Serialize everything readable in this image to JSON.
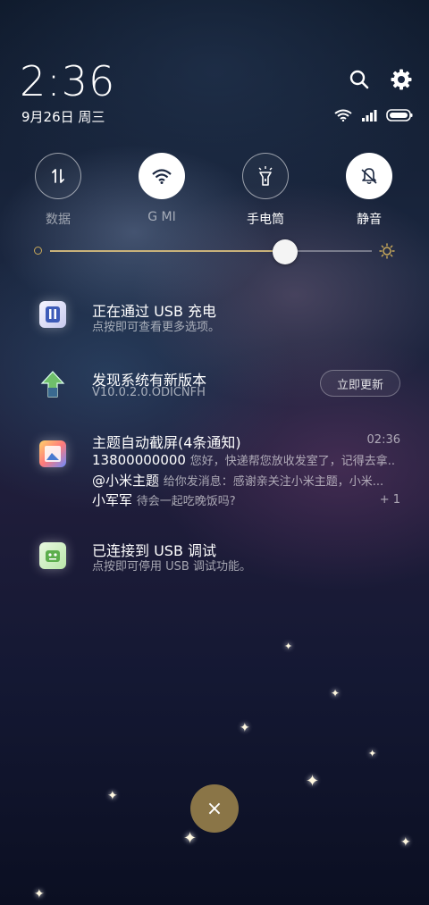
{
  "header": {
    "time": "2:36",
    "date": "9月26日 周三"
  },
  "toggles": [
    {
      "label": "数据",
      "state": "off",
      "icon": "data-arrows-icon"
    },
    {
      "label": "G    MI",
      "state": "on",
      "icon": "wifi-icon"
    },
    {
      "label": "手电筒",
      "state": "off",
      "icon": "flashlight-icon"
    },
    {
      "label": "静音",
      "state": "on",
      "icon": "bell-off-icon"
    }
  ],
  "brightness": {
    "level": 0.73
  },
  "notifications": {
    "usb_charging": {
      "title": "正在通过 USB 充电",
      "subtitle": "点按即可查看更多选项。"
    },
    "system_update": {
      "title": "发现系统有新版本",
      "subtitle": "V10.0.2.0.ODICNFH",
      "button": "立即更新"
    },
    "theme": {
      "title": "主题自动截屏(4条通知)",
      "time": "02:36",
      "lines": [
        {
          "sender": "13800000000",
          "text": "您好，快递帮您放收发室了，记得去拿..."
        },
        {
          "sender": "@小米主题",
          "text": "给你发消息：感谢亲关注小米主题，小米..."
        },
        {
          "sender": "小军军",
          "text": "待会一起吃晚饭吗?"
        }
      ],
      "more": "+ 1"
    },
    "usb_debug": {
      "title": "已连接到 USB 调试",
      "subtitle": "点按即可停用 USB 调试功能。"
    }
  },
  "close_button": {
    "label": "×"
  },
  "colors": {
    "accent": "#c9b27a",
    "close_bg": "#8a7547"
  }
}
